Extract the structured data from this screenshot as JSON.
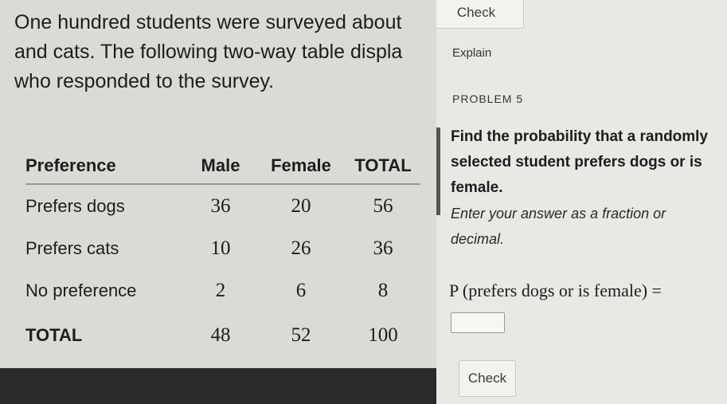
{
  "intro": {
    "line1": "One hundred students were surveyed about",
    "line2": "and cats. The following two-way table displa",
    "line3": "who responded to the survey."
  },
  "table": {
    "headers": [
      "Preference",
      "Male",
      "Female",
      "TOTAL"
    ],
    "rows": [
      {
        "label": "Prefers dogs",
        "values": [
          "36",
          "20",
          "56"
        ]
      },
      {
        "label": "Prefers cats",
        "values": [
          "10",
          "26",
          "36"
        ]
      },
      {
        "label": "No preference",
        "values": [
          "2",
          "6",
          "8"
        ]
      },
      {
        "label": "TOTAL",
        "values": [
          "48",
          "52",
          "100"
        ]
      }
    ]
  },
  "panel": {
    "check_top": "Check",
    "explain": "Explain",
    "problem_label": "PROBLEM 5",
    "question": "Find the probability that a randomly selected student prefers dogs or is female.",
    "instructions": "Enter your answer as a fraction or decimal.",
    "expression": "P (prefers dogs or is female) =",
    "answer_value": "",
    "check_bottom": "Check"
  }
}
